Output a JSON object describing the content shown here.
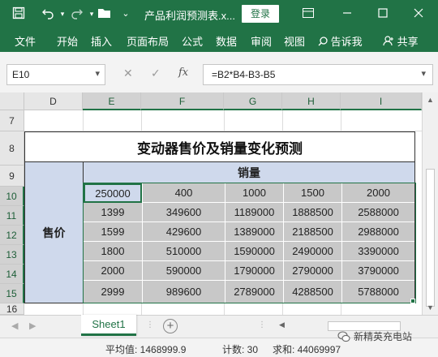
{
  "titlebar": {
    "title": "产品利润预测表.x...",
    "login_label": "登录",
    "icons": [
      "save-icon",
      "undo-icon",
      "redo-icon",
      "open-folder-icon",
      "quick-access-dropdown-icon",
      "ribbon-display-icon",
      "minimize-icon",
      "maximize-icon",
      "close-icon"
    ]
  },
  "ribbon": {
    "tabs": [
      "文件",
      "开始",
      "插入",
      "页面布局",
      "公式",
      "数据",
      "审阅",
      "视图"
    ],
    "tell_me": "告诉我",
    "share": "共享"
  },
  "formula_bar": {
    "name_box": "E10",
    "formula": "=B2*B4-B3-B5",
    "fx_label": "fx"
  },
  "columns": [
    "D",
    "E",
    "F",
    "G",
    "H",
    "I"
  ],
  "selected_columns": [
    "E",
    "F",
    "G",
    "H",
    "I"
  ],
  "rows": [
    "7",
    "8",
    "9",
    "10",
    "11",
    "12",
    "13",
    "14",
    "15",
    "16"
  ],
  "selected_rows": [
    "10",
    "11",
    "12",
    "13",
    "14",
    "15"
  ],
  "sheet": {
    "title": "变动器售价及销量变化预测",
    "sales_volume_label": "销量",
    "price_label": "售价",
    "top_left_value": "250000",
    "volumes": [
      "400",
      "1000",
      "1500",
      "2000"
    ],
    "prices": [
      "1399",
      "1599",
      "1800",
      "2000",
      "2999"
    ],
    "results": [
      [
        "349600",
        "1189000",
        "1888500",
        "2588000"
      ],
      [
        "429600",
        "1389000",
        "2188500",
        "2988000"
      ],
      [
        "510000",
        "1590000",
        "2490000",
        "3390000"
      ],
      [
        "590000",
        "1790000",
        "2790000",
        "3790000"
      ],
      [
        "989600",
        "2789000",
        "4288500",
        "5788000"
      ]
    ]
  },
  "sheet_tabs": {
    "active": "Sheet1",
    "add_label": "+"
  },
  "status_bar": {
    "average": "平均值: 1468999.9",
    "count": "计数: 30",
    "sum": "求和: 44069997"
  },
  "watermark": "新精英充电站",
  "colors": {
    "accent": "#217346",
    "header_blue": "#cfd9ec",
    "data_gray": "#c8c8c8"
  }
}
